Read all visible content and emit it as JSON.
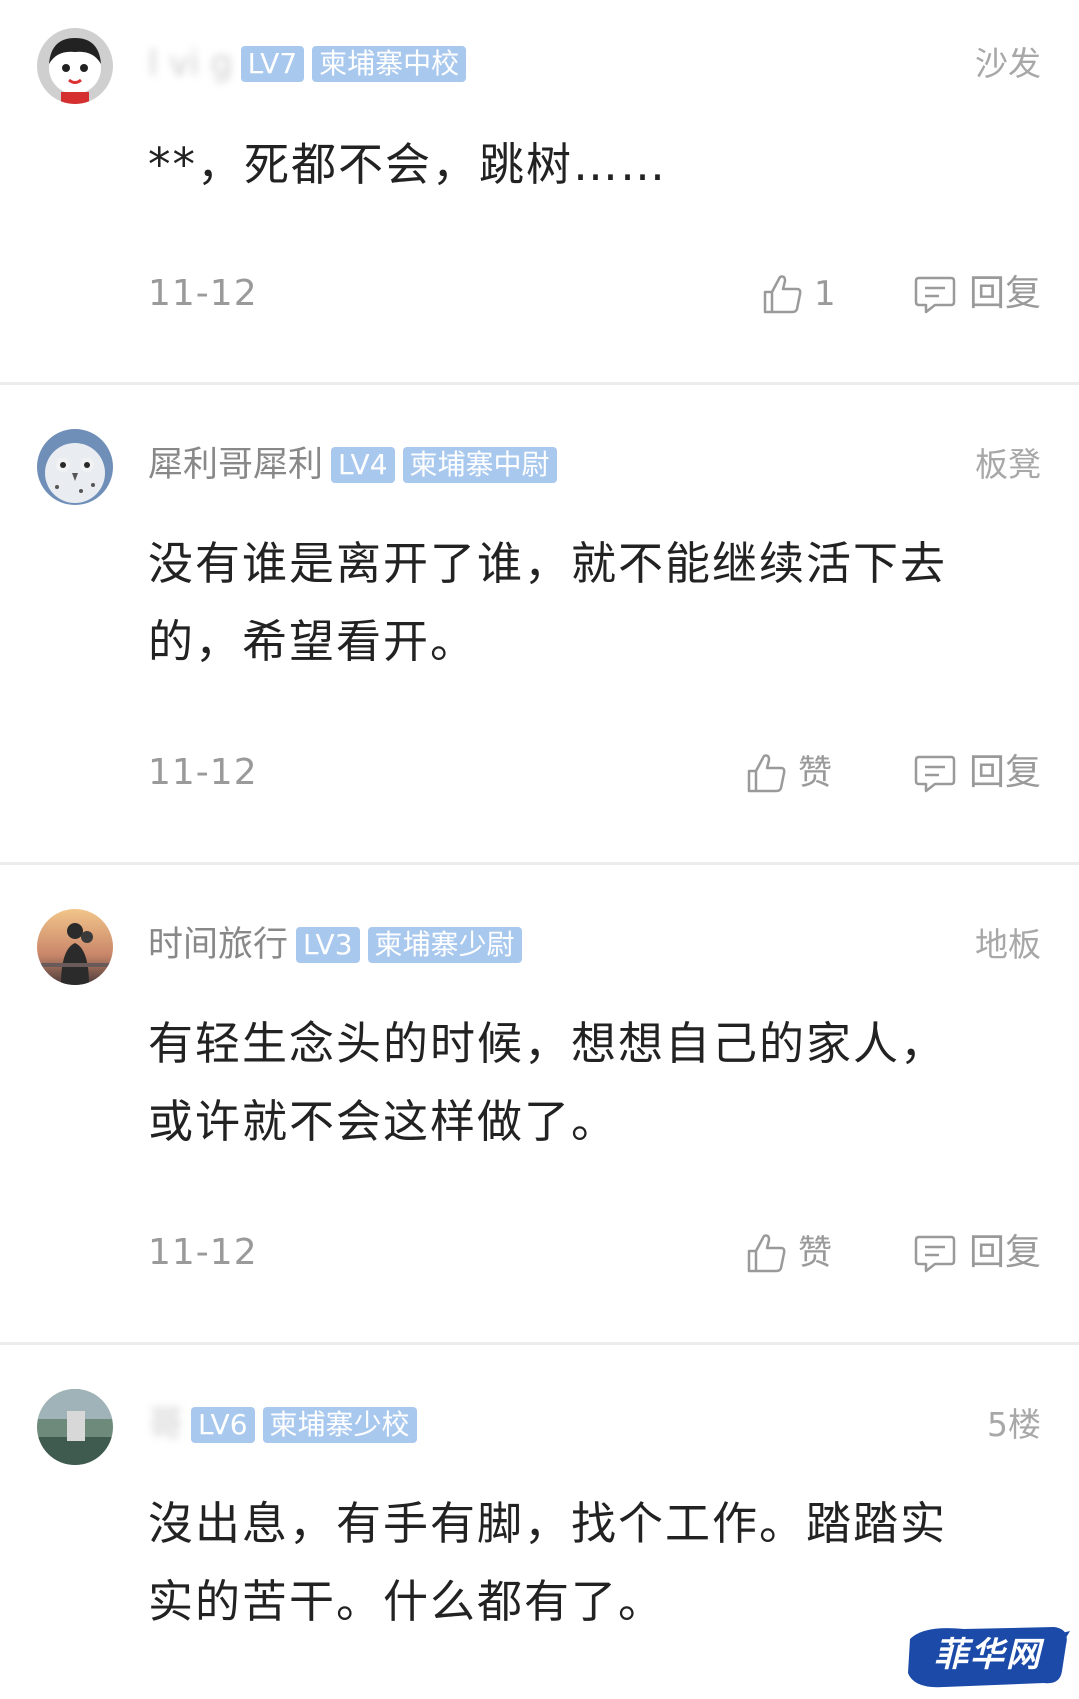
{
  "comments": [
    {
      "username": "l vi g",
      "username_blurred": true,
      "level": "LV7",
      "rank": "柬埔寨中校",
      "floor": "沙发",
      "text": "**，死都不会，跳树……",
      "date": "11-12",
      "like_label": "1",
      "reply_label": "回复",
      "avatar": "cartoon-face-icon"
    },
    {
      "username": "犀利哥犀利",
      "username_blurred": false,
      "level": "LV4",
      "rank": "柬埔寨中尉",
      "floor": "板凳",
      "text": "没有谁是离开了谁，就不能继续活下去的，希望看开。",
      "date": "11-12",
      "like_label": "赞",
      "reply_label": "回复",
      "avatar": "owl-photo-icon"
    },
    {
      "username": "时间旅行",
      "username_blurred": false,
      "level": "LV3",
      "rank": "柬埔寨少尉",
      "floor": "地板",
      "text": "有轻生念头的时候，想想自己的家人，或许就不会这样做了。",
      "date": "11-12",
      "like_label": "赞",
      "reply_label": "回复",
      "avatar": "sunset-couple-photo-icon"
    },
    {
      "username": "哥",
      "username_blurred": true,
      "level": "LV6",
      "rank": "柬埔寨少校",
      "floor": "5楼",
      "text": "沒出息，有手有脚，找个工作。踏踏实实的苦干。什么都有了。",
      "date": "",
      "like_label": "",
      "reply_label": "",
      "avatar": "blurred-photo-icon"
    }
  ],
  "watermark": {
    "text": "菲华网",
    "color": "#1b4aa8"
  },
  "colors": {
    "badge": "#a8c8ee",
    "divider": "#ececec",
    "muted_text": "#9a9a9a"
  }
}
